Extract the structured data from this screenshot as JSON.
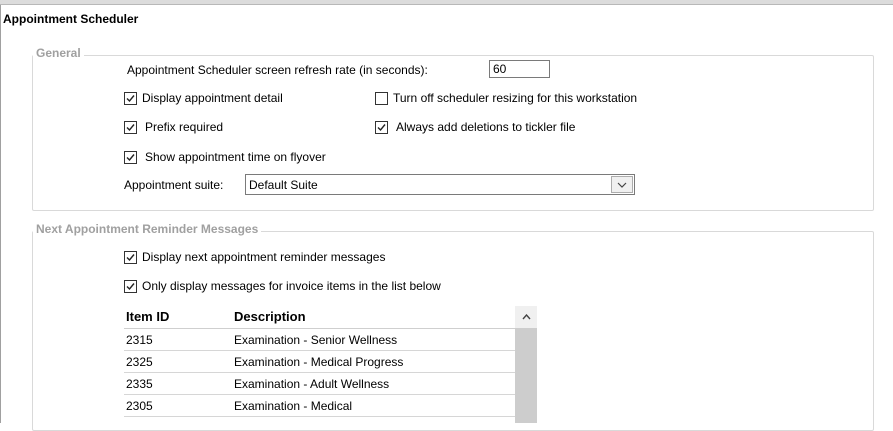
{
  "page_title": "Appointment Scheduler",
  "general": {
    "legend": "General",
    "refresh_label": "Appointment Scheduler screen refresh rate (in seconds):",
    "refresh_value": "60",
    "checkboxes": {
      "display_detail": {
        "label": "Display appointment detail",
        "checked": true
      },
      "turn_off_resizing": {
        "label": "Turn off scheduler resizing for this workstation",
        "checked": false
      },
      "prefix_required": {
        "label": "Prefix  required",
        "checked": true
      },
      "always_add_deletions": {
        "label": "Always add deletions to tickler file",
        "checked": true
      },
      "show_time_flyover": {
        "label": "Show appointment time on flyover",
        "checked": true
      }
    },
    "suite_label": "Appointment suite:",
    "suite_value": "Default Suite"
  },
  "reminders": {
    "legend": "Next Appointment Reminder Messages",
    "checkboxes": {
      "display_reminders": {
        "label": "Display next appointment reminder messages",
        "checked": true
      },
      "only_invoice_items": {
        "label": "Only display messages for invoice items in the list below",
        "checked": true
      }
    },
    "table": {
      "headers": {
        "item_id": "Item ID",
        "description": "Description"
      },
      "rows": [
        {
          "item_id": "2315",
          "description": "Examination - Senior Wellness"
        },
        {
          "item_id": "2325",
          "description": "Examination - Medical Progress"
        },
        {
          "item_id": "2335",
          "description": "Examination - Adult Wellness"
        },
        {
          "item_id": "2305",
          "description": "Examination - Medical"
        }
      ]
    }
  },
  "icons": {
    "checkmark": "checkmark-icon",
    "dropdown": "chevron-down-icon",
    "scroll_up": "chevron-up-icon"
  }
}
